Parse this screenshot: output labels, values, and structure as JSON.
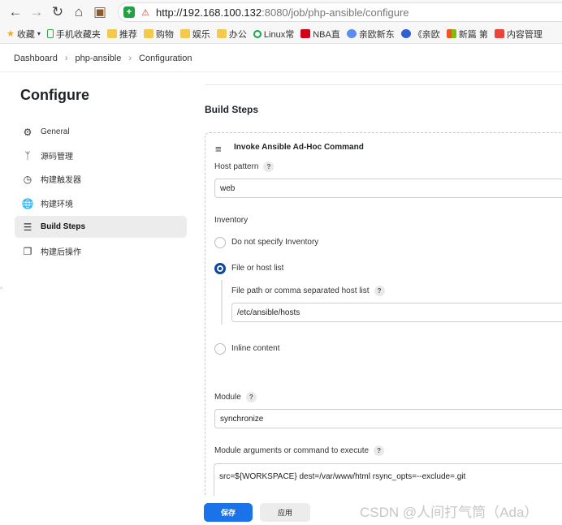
{
  "browser": {
    "url_host": "http://192.168.100.132",
    "url_rest": ":8080/job/php-ansible/configure",
    "bookmarks": [
      "收藏",
      "手机收藏夹",
      "推荐",
      "购物",
      "娱乐",
      "办公",
      "Linux常",
      "NBA直",
      "亲欧新东",
      "《亲欧",
      "新篇 第",
      "内容管理"
    ]
  },
  "breadcrumb": [
    "Dashboard",
    "php-ansible",
    "Configuration"
  ],
  "sidebar": {
    "title": "Configure",
    "items": [
      {
        "label": "General",
        "icon": "gear-icon"
      },
      {
        "label": "源码管理",
        "icon": "branch-icon"
      },
      {
        "label": "构建触发器",
        "icon": "clock-icon"
      },
      {
        "label": "构建环境",
        "icon": "globe-icon"
      },
      {
        "label": "Build Steps",
        "icon": "list-icon",
        "active": true
      },
      {
        "label": "构建后操作",
        "icon": "cube-icon"
      }
    ]
  },
  "main": {
    "section_title": "Build Steps",
    "step_title": "Invoke Ansible Ad-Hoc Command",
    "host_pattern_label": "Host pattern",
    "host_pattern_value": "web",
    "inventory_label": "Inventory",
    "inventory_options": [
      "Do not specify Inventory",
      "File or host list",
      "Inline content"
    ],
    "inventory_selected": "File or host list",
    "file_path_label": "File path or comma separated host list",
    "file_path_value": "/etc/ansible/hosts",
    "module_label": "Module",
    "module_value": "synchronize",
    "module_args_label": "Module arguments or command to execute",
    "module_args_value": "src=${WORKSPACE} dest=/var/www/html rsync_opts=--exclude=.git"
  },
  "actions": {
    "save": "保存",
    "apply": "应用"
  },
  "watermark": "CSDN @人间打气筒（Ada）",
  "colors": {
    "primary": "#1a73e8",
    "active_bg": "#ececec"
  }
}
